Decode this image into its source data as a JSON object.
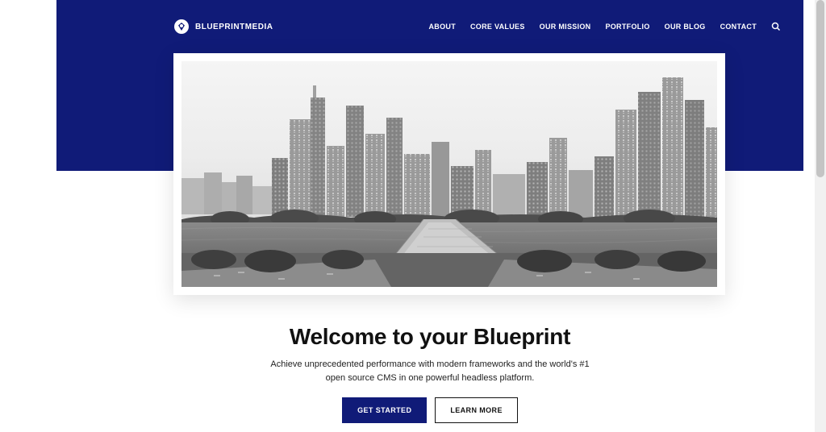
{
  "brand": {
    "name": "BLUEPRINTMEDIA"
  },
  "nav": {
    "items": [
      {
        "label": "ABOUT"
      },
      {
        "label": "CORE VALUES"
      },
      {
        "label": "OUR MISSION"
      },
      {
        "label": "PORTFOLIO"
      },
      {
        "label": "OUR BLOG"
      },
      {
        "label": "CONTACT"
      }
    ]
  },
  "hero": {
    "image_alt": "City skyline with river and bridge, black and white"
  },
  "welcome": {
    "title": "Welcome to your Blueprint",
    "subtitle": "Achieve unprecedented performance with modern frameworks and the world's #1 open source CMS in one powerful headless platform."
  },
  "cta": {
    "primary": "GET STARTED",
    "secondary": "LEARN MORE"
  },
  "colors": {
    "navy": "#101b78"
  }
}
